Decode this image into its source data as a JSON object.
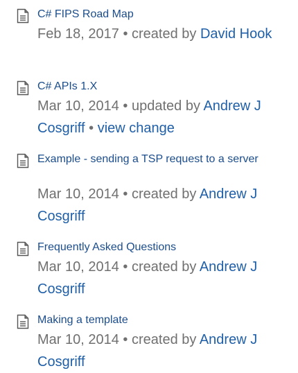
{
  "entries": [
    {
      "title": "C# FIPS Road Map",
      "date": "Feb 18, 2017",
      "action": "created by",
      "author": "David Hook",
      "extra": ""
    },
    {
      "title": "C# APIs 1.X",
      "date": "Mar 10, 2014",
      "action": "updated by",
      "author": "Andrew J Cosgriff",
      "extra": "view change"
    },
    {
      "title": "Example - sending a TSP request to a server",
      "date": "Mar 10, 2014",
      "action": "created by",
      "author": "Andrew J Cosgriff",
      "extra": ""
    },
    {
      "title": "Frequently Asked Questions",
      "date": "Mar 10, 2014",
      "action": "created by",
      "author": "Andrew J Cosgriff",
      "extra": ""
    },
    {
      "title": "Making a template",
      "date": "Mar 10, 2014",
      "action": "created by",
      "author": "Andrew J Cosgriff",
      "extra": ""
    }
  ],
  "separator": "•",
  "icons": {
    "page": "document-page-icon"
  },
  "colors": {
    "link": "#1b4d8c",
    "meta": "#707070"
  }
}
